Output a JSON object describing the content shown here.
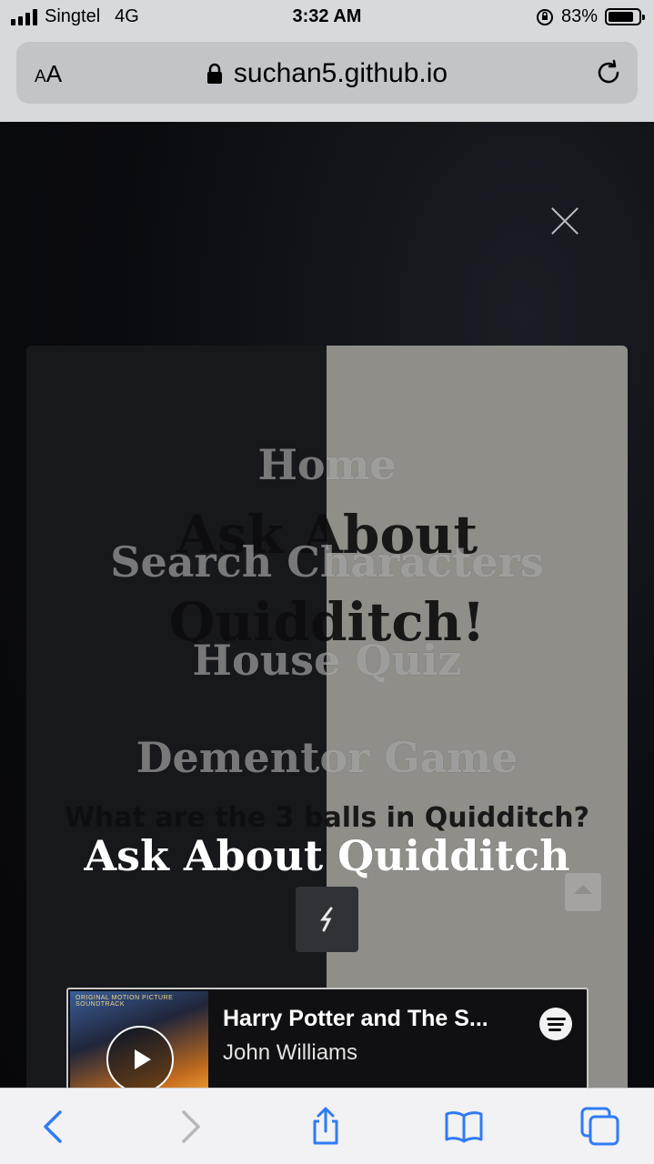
{
  "status_bar": {
    "carrier": "Singtel",
    "network": "4G",
    "time": "3:32 AM",
    "battery_percent": "83%",
    "battery_level": 0.83
  },
  "browser": {
    "text_size_label": "AA",
    "url": "suchan5.github.io"
  },
  "page": {
    "card_title": "Ask About Quidditch!",
    "question": "What are the 3 balls in Quidditch?",
    "player": {
      "track": "Harry Potter and The S...",
      "artist": "John Williams",
      "album_caption": "ORIGINAL MOTION PICTURE SOUNDTRACK"
    }
  },
  "menu": {
    "items": [
      {
        "label": "Home"
      },
      {
        "label": "Search Characters"
      },
      {
        "label": "House Quiz"
      },
      {
        "label": "Dementor Game"
      },
      {
        "label": "Ask About Quidditch"
      }
    ],
    "active_index": 4
  },
  "colors": {
    "accent_blue": "#2f7bf5",
    "disabled_gray": "#b7b7bb"
  },
  "toolbar": {
    "icons": [
      "back-icon",
      "forward-icon",
      "share-icon",
      "bookmarks-icon",
      "tabs-icon"
    ]
  }
}
